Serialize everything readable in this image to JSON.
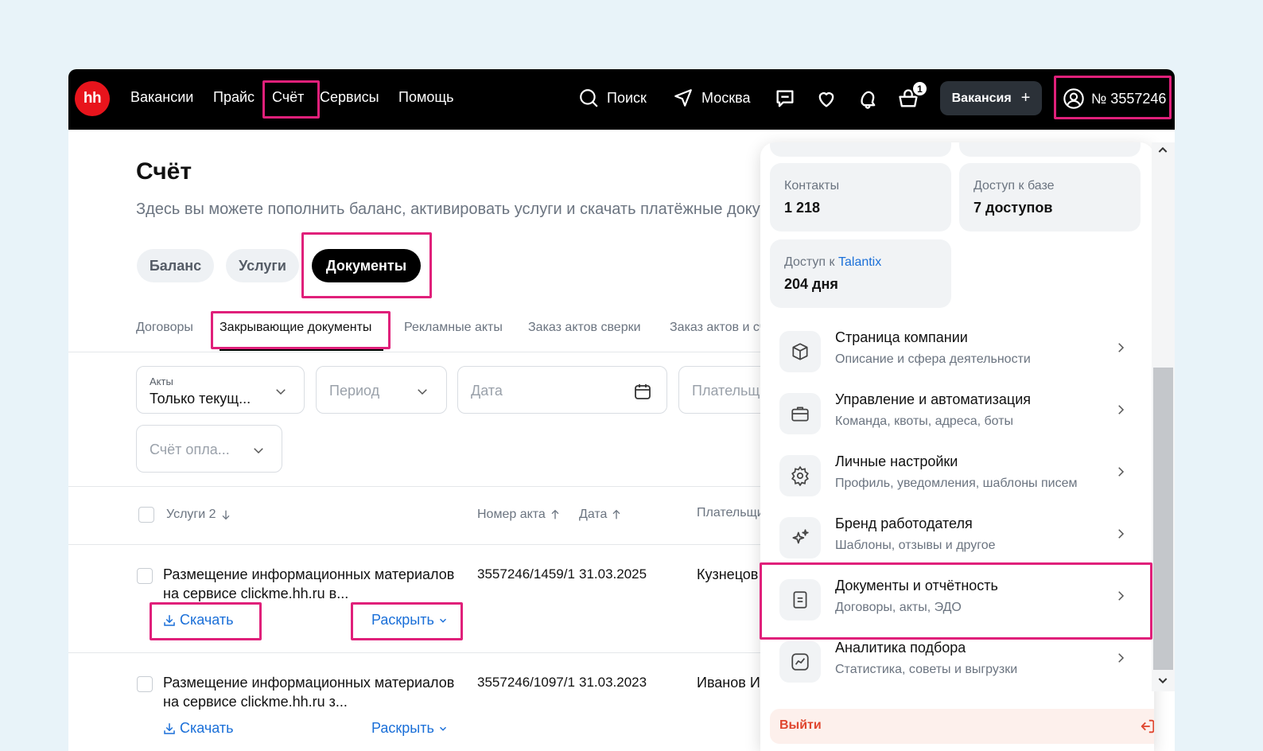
{
  "topbar": {
    "logo": "hh",
    "nav": [
      "Вакансии",
      "Прайс",
      "Счёт",
      "Сервисы",
      "Помощь"
    ],
    "search_label": "Поиск",
    "location_label": "Москва",
    "cart_badge": "1",
    "vacancy_button": "Вакансия",
    "account_label": "№ 3557246"
  },
  "page": {
    "title": "Счёт",
    "subtitle": "Здесь вы можете пополнить баланс, активировать услуги и скачать платёжные документы",
    "tabs": [
      "Баланс",
      "Услуги",
      "Документы"
    ],
    "subtabs": [
      "Договоры",
      "Закрывающие документы",
      "Рекламные акты",
      "Заказ актов сверки",
      "Заказ актов и счетов"
    ]
  },
  "filters": {
    "acts_label": "Акты",
    "acts_value": "Только текущ...",
    "period_placeholder": "Период",
    "date_placeholder": "Дата",
    "payer_placeholder": "Плательщик",
    "invoice_placeholder": "Счёт опла..."
  },
  "table": {
    "headers": [
      "Услуги 2",
      "Номер акта",
      "Дата",
      "Плательщик"
    ],
    "rows": [
      {
        "service": "Размещение информационных материалов на сервисе clickme.hh.ru в...",
        "act": "3557246/1459/1",
        "date": "31.03.2025",
        "payer": "Кузнецов",
        "download": "Скачать",
        "expand": "Раскрыть"
      },
      {
        "service": "Размещение информационных материалов на сервисе clickme.hh.ru з...",
        "act": "3557246/1097/1",
        "date": "31.03.2023",
        "payer": "Иванов И",
        "download": "Скачать",
        "expand": "Раскрыть"
      }
    ]
  },
  "panel": {
    "stats": [
      {
        "label": "Контакты",
        "value": "1 218"
      },
      {
        "label": "Доступ к базе",
        "value": "7 доступов"
      },
      {
        "label_prefix": "Доступ к ",
        "label_accent": "Talantix",
        "value": "204 дня"
      }
    ],
    "menu": [
      {
        "title": "Страница компании",
        "subtitle": "Описание и сфера деятельности",
        "icon": "cube-icon"
      },
      {
        "title": "Управление и автоматизация",
        "subtitle": "Команда, квоты, адреса, боты",
        "icon": "briefcase-icon"
      },
      {
        "title": "Личные настройки",
        "subtitle": "Профиль, уведомления, шаблоны писем",
        "icon": "gear-icon"
      },
      {
        "title": "Бренд работодателя",
        "subtitle": "Шаблоны, отзывы и другое",
        "icon": "sparkle-icon"
      },
      {
        "title": "Документы и отчётность",
        "subtitle": "Договоры, акты, ЭДО",
        "icon": "document-icon"
      },
      {
        "title": "Аналитика подбора",
        "subtitle": "Статистика, советы и выгрузки",
        "icon": "chart-icon"
      }
    ],
    "logout": "Выйти"
  },
  "colors": {
    "highlight": "#e0207a",
    "accent_link": "#1a6fd8",
    "logo_red": "#e8141c",
    "logout_text": "#e0462f"
  }
}
